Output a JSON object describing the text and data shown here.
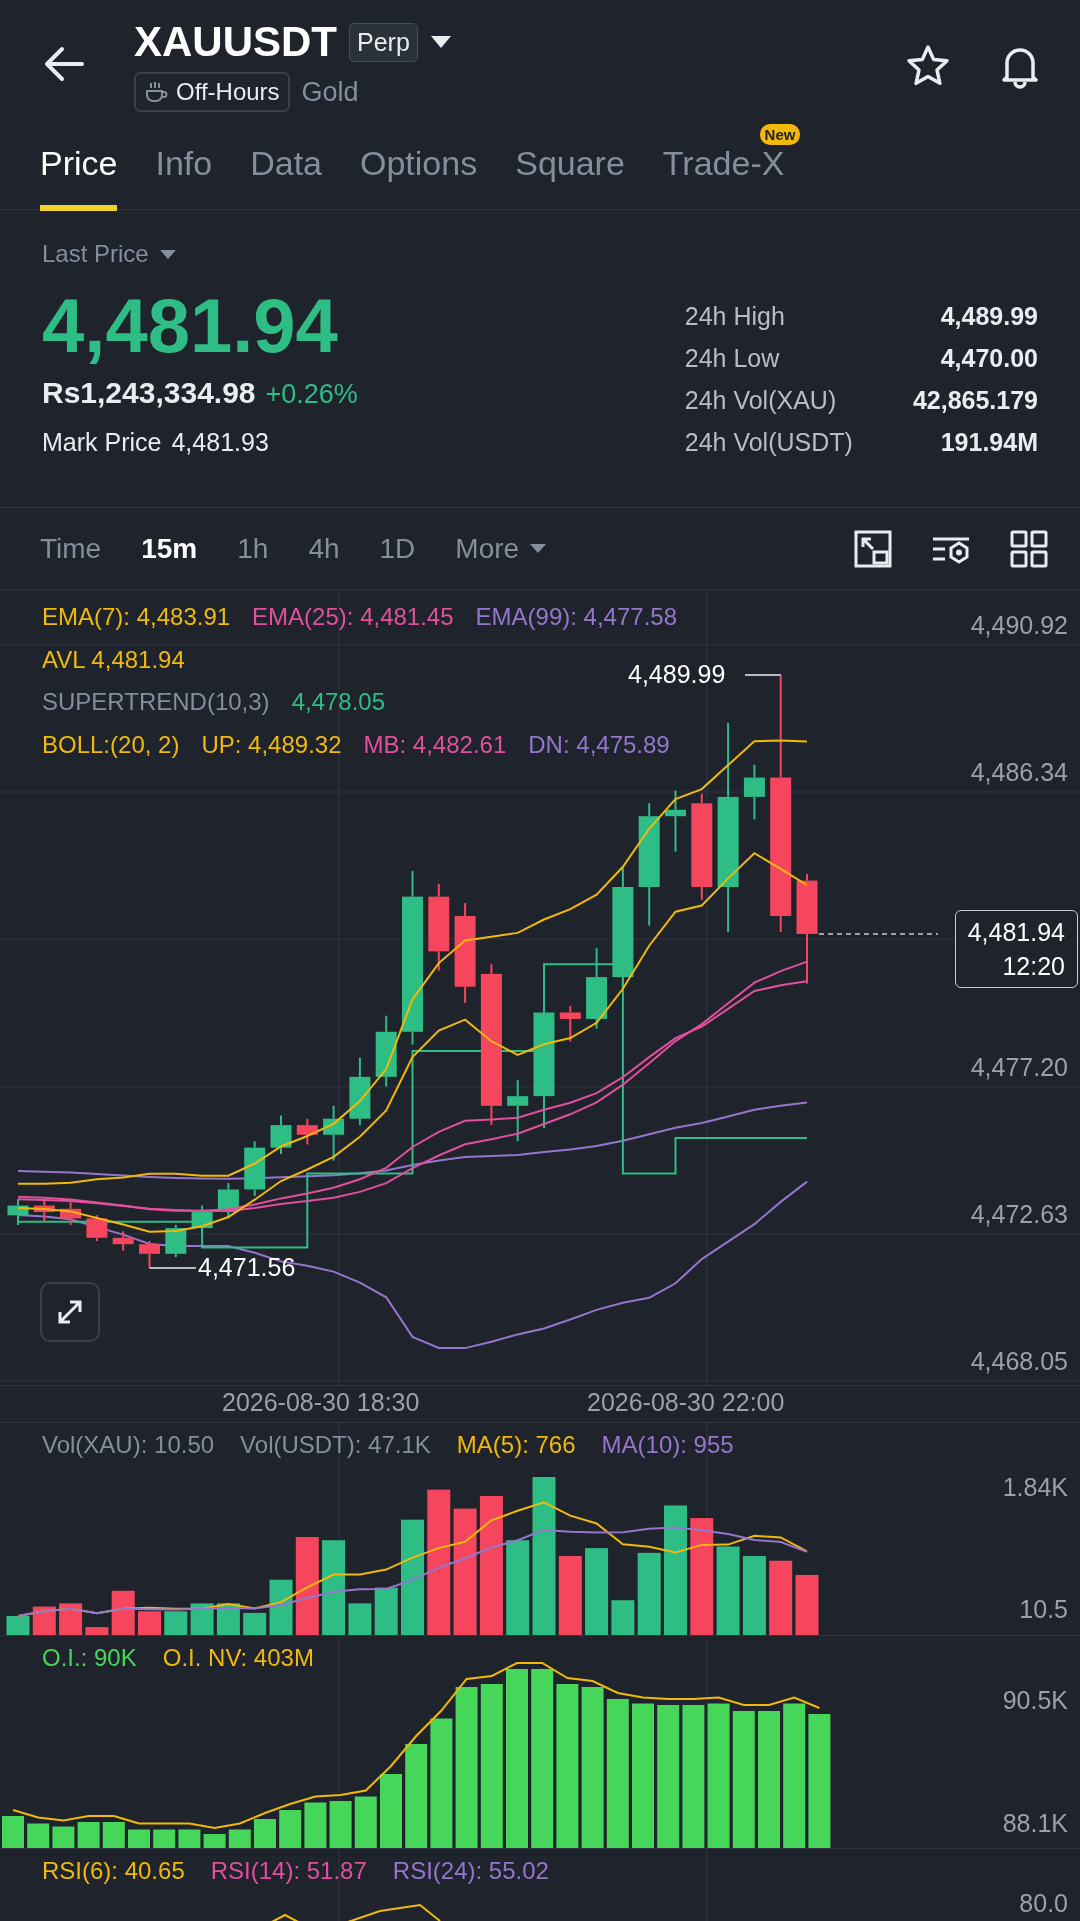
{
  "header": {
    "symbol": "XAUUSDT",
    "contract_badge": "Perp",
    "session_badge": "Off-Hours",
    "asset_name": "Gold"
  },
  "tabs": [
    {
      "label": "Price",
      "selected": true
    },
    {
      "label": "Info",
      "selected": false
    },
    {
      "label": "Data",
      "selected": false
    },
    {
      "label": "Options",
      "selected": false
    },
    {
      "label": "Square",
      "selected": false
    },
    {
      "label": "Trade-X",
      "selected": false,
      "badge": "New"
    }
  ],
  "price_panel": {
    "price_type": "Last Price",
    "last_price": "4,481.94",
    "fiat_price": "Rs1,243,334.98",
    "change": "+0.26%",
    "mark_price_label": "Mark Price",
    "mark_price": "4,481.93",
    "stats": [
      {
        "label": "24h High",
        "value": "4,489.99"
      },
      {
        "label": "24h Low",
        "value": "4,470.00"
      },
      {
        "label": "24h Vol(XAU)",
        "value": "42,865.179"
      },
      {
        "label": "24h Vol(USDT)",
        "value": "191.94M"
      }
    ]
  },
  "intervals": [
    {
      "label": "Time",
      "selected": false,
      "kind": "option"
    },
    {
      "label": "15m",
      "selected": true,
      "kind": "option"
    },
    {
      "label": "1h",
      "selected": false,
      "kind": "option"
    },
    {
      "label": "4h",
      "selected": false,
      "kind": "option"
    },
    {
      "label": "1D",
      "selected": false,
      "kind": "option"
    },
    {
      "label": "More",
      "selected": false,
      "kind": "dropdown"
    }
  ],
  "main_chart": {
    "legend_rows": [
      [
        {
          "text": "EMA(7): 4,483.91",
          "color": "#f0b90b"
        },
        {
          "text": "EMA(25): 4,481.45",
          "color": "#e0509e"
        },
        {
          "text": "EMA(99): 4,477.58",
          "color": "#9575cd"
        }
      ],
      [
        {
          "text": "AVL 4,481.94",
          "color": "#f0b90b"
        }
      ],
      [
        {
          "text": "SUPERTREND(10,3)",
          "color": "#848e9c"
        },
        {
          "text": "4,478.05",
          "color": "#2ebd85"
        }
      ],
      [
        {
          "text": "BOLL:(20, 2)",
          "color": "#f0b90b"
        },
        {
          "text": "UP: 4,489.32",
          "color": "#f0b90b"
        },
        {
          "text": "MB: 4,482.61",
          "color": "#e0509e"
        },
        {
          "text": "DN: 4,475.89",
          "color": "#9575cd"
        }
      ]
    ],
    "price_axis": [
      {
        "kind": "tick",
        "label": "4,490.92"
      },
      {
        "kind": "tick",
        "label": "4,486.34"
      },
      {
        "kind": "price_tag",
        "price": "4,481.94",
        "countdown": "12:20"
      },
      {
        "kind": "tick",
        "label": "4,477.20"
      },
      {
        "kind": "tick",
        "label": "4,472.63"
      },
      {
        "kind": "tick",
        "label": "4,468.05"
      }
    ],
    "high_marker": "4,489.99",
    "low_marker": "4,471.56",
    "time_axis": [
      "2026-08-30 18:30",
      "2026-08-30 22:00"
    ]
  },
  "volume_panel": {
    "legend": [
      {
        "text": "Vol(XAU): 10.50",
        "color": "#848e9c"
      },
      {
        "text": "Vol(USDT): 47.1K",
        "color": "#848e9c"
      },
      {
        "text": "MA(5): 766",
        "color": "#f0b90b"
      },
      {
        "text": "MA(10): 955",
        "color": "#9575cd"
      }
    ],
    "axis": [
      "1.84K",
      "10.5"
    ]
  },
  "oi_panel": {
    "legend": [
      {
        "text": "O.I.: 90K",
        "color": "#45d65a"
      },
      {
        "text": "O.I. NV: 403M",
        "color": "#f0b90b"
      }
    ],
    "axis": [
      "90.5K",
      "88.1K"
    ]
  },
  "rsi_panel": {
    "legend": [
      {
        "text": "RSI(6): 40.65",
        "color": "#f0b90b"
      },
      {
        "text": "RSI(14): 51.87",
        "color": "#e0509e"
      },
      {
        "text": "RSI(24): 55.02",
        "color": "#9575cd"
      }
    ],
    "axis": [
      "80.0"
    ]
  }
}
